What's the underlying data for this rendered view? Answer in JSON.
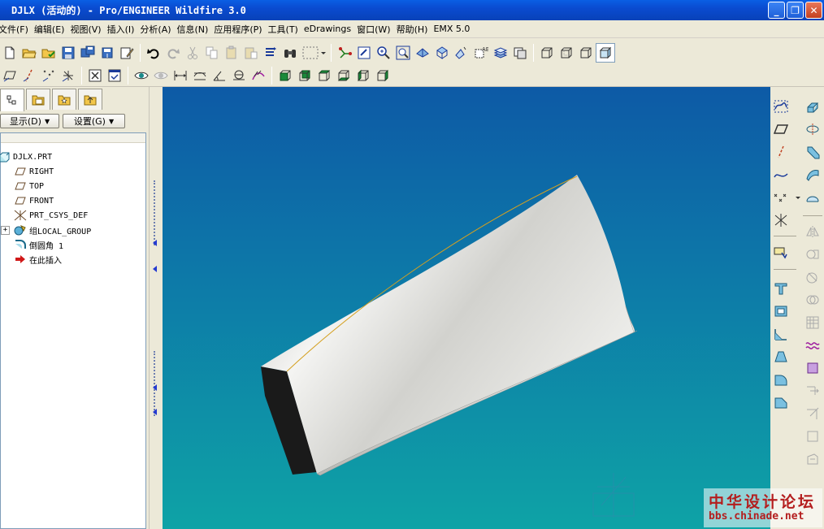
{
  "window": {
    "title": "DJLX (活动的) - Pro/ENGINEER Wildfire 3.0",
    "min_glyph": "_",
    "max_glyph": "❐",
    "close_glyph": "✕"
  },
  "menubar": {
    "items": [
      "文件(F)",
      "编辑(E)",
      "视图(V)",
      "插入(I)",
      "分析(A)",
      "信息(N)",
      "应用程序(P)",
      "工具(T)",
      "eDrawings",
      "窗口(W)",
      "帮助(H)",
      "EMX 5.0"
    ]
  },
  "panel": {
    "show_label": "显示(D)",
    "settings_label": "设置(G)",
    "tree": [
      {
        "label": "DJLX.PRT",
        "icon": "part-icon"
      },
      {
        "label": "RIGHT",
        "icon": "datum-plane-icon"
      },
      {
        "label": "TOP",
        "icon": "datum-plane-icon"
      },
      {
        "label": "FRONT",
        "icon": "datum-plane-icon"
      },
      {
        "label": "PRT_CSYS_DEF",
        "icon": "csys-icon"
      },
      {
        "label": "组LOCAL_GROUP",
        "icon": "group-icon"
      },
      {
        "label": "倒圆角 1",
        "icon": "round-icon"
      },
      {
        "label": "在此插入",
        "icon": "insert-here-arrow-icon"
      }
    ],
    "expand_glyph": "+"
  },
  "watermark": {
    "text": "中华设计论坛",
    "url": "bbs.chinade.net"
  },
  "colors": {
    "viewport_top": "#0d5aa6",
    "viewport_bottom": "#0ea3a6",
    "model_surface": "#e8e8e4",
    "edge_highlight": "#d4a020"
  }
}
